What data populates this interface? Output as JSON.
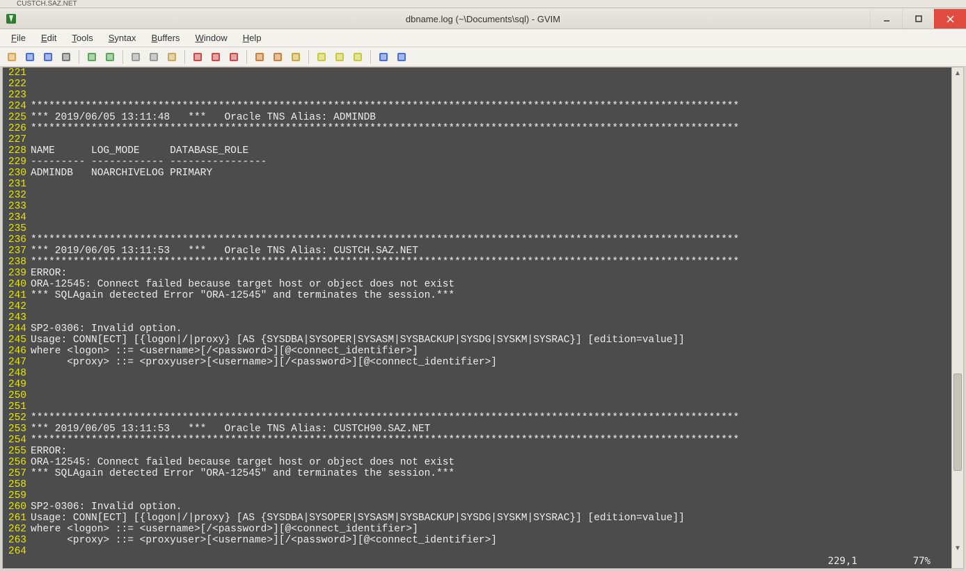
{
  "remnant_tab": "CUSTCH.SAZ.NET",
  "window": {
    "title": "dbname.log (~\\Documents\\sql) - GVIM"
  },
  "menu": {
    "items": [
      {
        "label": "File",
        "accel": "F"
      },
      {
        "label": "Edit",
        "accel": "E"
      },
      {
        "label": "Tools",
        "accel": "T"
      },
      {
        "label": "Syntax",
        "accel": "S"
      },
      {
        "label": "Buffers",
        "accel": "B"
      },
      {
        "label": "Window",
        "accel": "W"
      },
      {
        "label": "Help",
        "accel": "H"
      }
    ]
  },
  "toolbar_groups": [
    [
      "open-icon",
      "save-icon",
      "save-all-icon",
      "print-icon"
    ],
    [
      "undo-icon",
      "redo-icon"
    ],
    [
      "cut-icon",
      "copy-icon",
      "paste-icon"
    ],
    [
      "find-icon",
      "find-next-icon",
      "find-prev-icon"
    ],
    [
      "load-session-icon",
      "save-session-icon",
      "run-script-icon"
    ],
    [
      "make-icon",
      "shell-icon",
      "tag-icon"
    ],
    [
      "help-icon",
      "find-help-icon"
    ]
  ],
  "log": {
    "first_line_no": 221,
    "lines": [
      "",
      "",
      "",
      "*********************************************************************************************************************",
      "*** 2019/06/05 13:11:48   ***   Oracle TNS Alias: ADMINDB",
      "*********************************************************************************************************************",
      "",
      "NAME      LOG_MODE     DATABASE_ROLE",
      "--------- ------------ ----------------",
      "ADMINDB   NOARCHIVELOG PRIMARY",
      "",
      "",
      "",
      "",
      "",
      "*********************************************************************************************************************",
      "*** 2019/06/05 13:11:53   ***   Oracle TNS Alias: CUSTCH.SAZ.NET",
      "*********************************************************************************************************************",
      "ERROR:",
      "ORA-12545: Connect failed because target host or object does not exist",
      "*** SQLAgain detected Error \"ORA-12545\" and terminates the session.***",
      "",
      "",
      "SP2-0306: Invalid option.",
      "Usage: CONN[ECT] [{logon|/|proxy} [AS {SYSDBA|SYSOPER|SYSASM|SYSBACKUP|SYSDG|SYSKM|SYSRAC}] [edition=value]]",
      "where <logon> ::= <username>[/<password>][@<connect_identifier>]",
      "      <proxy> ::= <proxyuser>[<username>][/<password>][@<connect_identifier>]",
      "",
      "",
      "",
      "",
      "*********************************************************************************************************************",
      "*** 2019/06/05 13:11:53   ***   Oracle TNS Alias: CUSTCH90.SAZ.NET",
      "*********************************************************************************************************************",
      "ERROR:",
      "ORA-12545: Connect failed because target host or object does not exist",
      "*** SQLAgain detected Error \"ORA-12545\" and terminates the session.***",
      "",
      "",
      "SP2-0306: Invalid option.",
      "Usage: CONN[ECT] [{logon|/|proxy} [AS {SYSDBA|SYSOPER|SYSASM|SYSBACKUP|SYSDG|SYSKM|SYSRAC}] [edition=value]]",
      "where <logon> ::= <username>[/<password>][@<connect_identifier>]",
      "      <proxy> ::= <proxyuser>[<username>][/<password>][@<connect_identifier>]",
      ""
    ]
  },
  "status": {
    "position": "229,1",
    "percent": "77%"
  }
}
